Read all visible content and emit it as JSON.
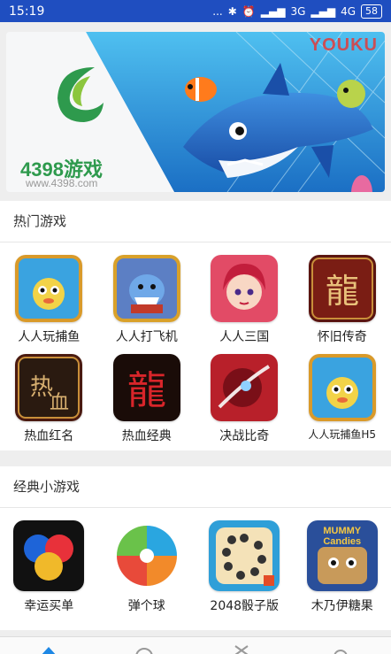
{
  "status_bar": {
    "time": "15:19",
    "dots": "...",
    "network1": "3G",
    "network2": "4G",
    "battery": "58"
  },
  "banner": {
    "logo_text": "4398游戏",
    "logo_url": "www.4398.com",
    "watermark": "YOUKU"
  },
  "hot_section": {
    "title": "热门游戏",
    "games": [
      {
        "label": "人人玩捕鱼",
        "icon": "fish-game-icon"
      },
      {
        "label": "人人打飞机",
        "icon": "shark-plane-game-icon"
      },
      {
        "label": "人人三国",
        "icon": "three-kingdoms-game-icon"
      },
      {
        "label": "怀旧传奇",
        "icon": "dragon-legend-game-icon"
      },
      {
        "label": "热血红名",
        "icon": "hot-blood-game-icon"
      },
      {
        "label": "热血经典",
        "icon": "red-dragon-game-icon"
      },
      {
        "label": "决战比奇",
        "icon": "battle-game-icon"
      },
      {
        "label": "人人玩捕鱼H5",
        "icon": "fish-h5-game-icon"
      }
    ]
  },
  "classic_section": {
    "title": "经典小游戏",
    "games": [
      {
        "label": "幸运买单",
        "icon": "lucky-balls-icon"
      },
      {
        "label": "弹个球",
        "icon": "beach-ball-icon"
      },
      {
        "label": "2048骰子版",
        "icon": "dice-icon"
      },
      {
        "label": "木乃伊糖果",
        "icon": "mummy-candies-icon"
      }
    ],
    "mummy_logo_text": "MUMMY Candies"
  },
  "tab_bar": {
    "tabs": [
      "home-icon",
      "circle-icon",
      "game-icon",
      "search-icon"
    ]
  },
  "colors": {
    "status_bar": "#1f4ec0",
    "accent": "#1e88e5"
  }
}
